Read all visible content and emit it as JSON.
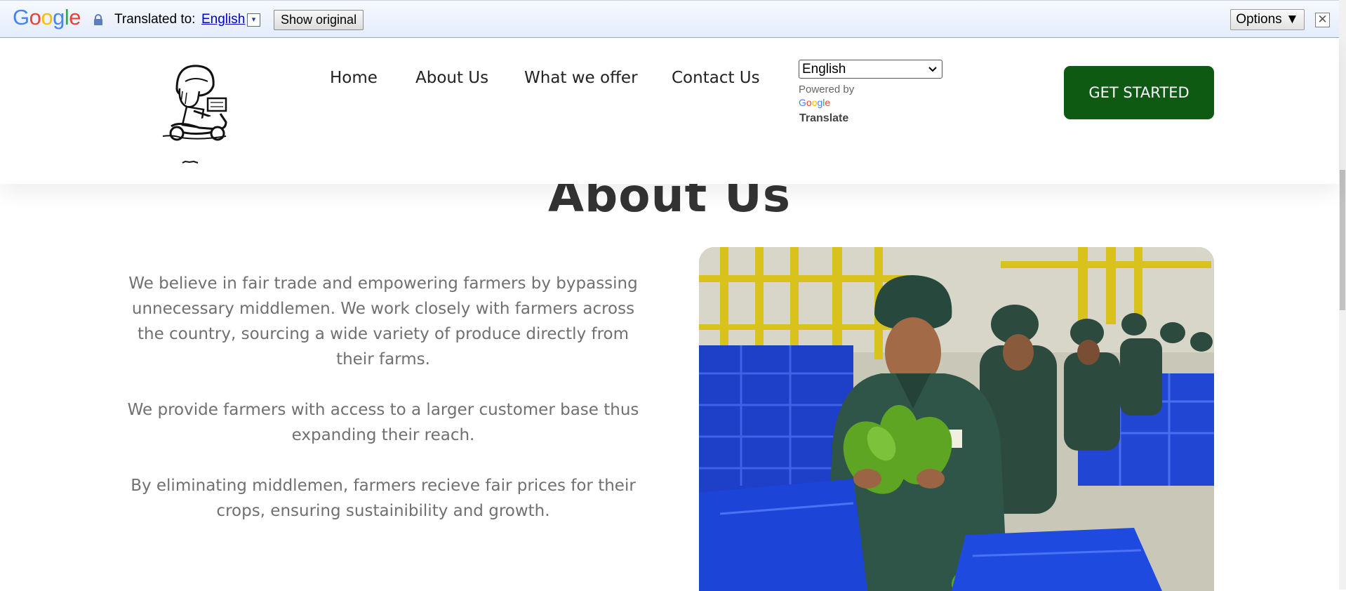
{
  "translate_bar": {
    "logo_text": "Google",
    "translated_label": "Translated to:",
    "language": "English",
    "language_dropdown_glyph": "▾",
    "show_original_label": "Show original",
    "options_label": "Options ▼",
    "close_glyph": "✕",
    "icons": [
      "lock-icon",
      "close-icon"
    ]
  },
  "header": {
    "nav": {
      "home": "Home",
      "about": "About Us",
      "offer": "What we offer",
      "contact": "Contact Us"
    },
    "language_select": {
      "selected": "English"
    },
    "powered_by": "Powered by",
    "powered_logo": "Google",
    "translate": "Translate",
    "cta": "GET STARTED"
  },
  "main": {
    "title": "About Us",
    "paragraphs": [
      "We believe in fair trade and empowering farmers by bypassing unnecessary middlemen. We work closely with farmers across the country, sourcing a wide variety of produce directly from their farms.",
      "We provide farmers with access to a larger customer base thus expanding their reach.",
      "By eliminating middlemen, farmers recieve fair prices for their crops, ensuring sustainibility and growth."
    ]
  },
  "colors": {
    "cta_background": "#0e5a12",
    "title_text": "#333333",
    "body_text": "#707070",
    "link_blue": "#0000cc"
  }
}
